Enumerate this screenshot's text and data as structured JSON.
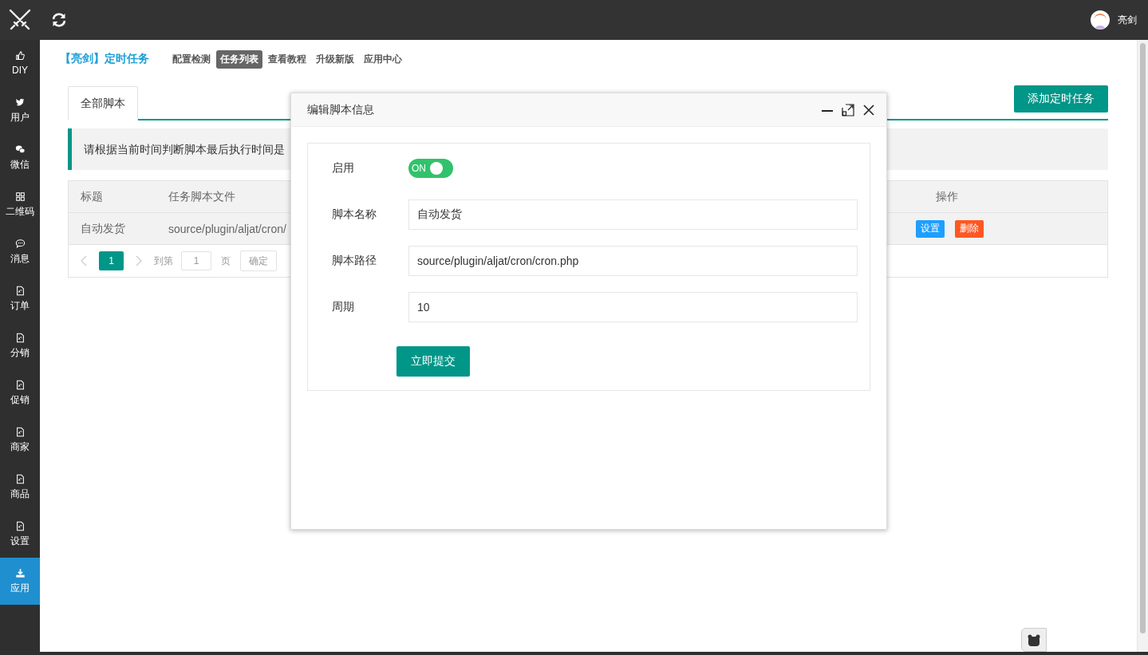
{
  "header": {
    "user_name": "亮剑"
  },
  "sidebar": {
    "items": [
      {
        "label": "DIY",
        "kind": "thumb",
        "selected": false
      },
      {
        "label": "用户",
        "kind": "bird",
        "selected": false
      },
      {
        "label": "微信",
        "kind": "chat",
        "selected": false
      },
      {
        "label": "二维码",
        "kind": "grid",
        "selected": false
      },
      {
        "label": "消息",
        "kind": "bubble",
        "selected": false
      },
      {
        "label": "订单",
        "kind": "doc",
        "selected": false
      },
      {
        "label": "分销",
        "kind": "doc",
        "selected": false
      },
      {
        "label": "促销",
        "kind": "doc",
        "selected": false
      },
      {
        "label": "商家",
        "kind": "doc",
        "selected": false
      },
      {
        "label": "商品",
        "kind": "doc",
        "selected": false
      },
      {
        "label": "设置",
        "kind": "doc",
        "selected": false
      },
      {
        "label": "应用",
        "kind": "download",
        "selected": true
      }
    ]
  },
  "page": {
    "title": "【亮剑】定时任务",
    "nav": [
      {
        "label": "配置检测",
        "selected": false
      },
      {
        "label": "任务列表",
        "selected": true
      },
      {
        "label": "查看教程",
        "selected": false
      },
      {
        "label": "升级新版",
        "selected": false
      },
      {
        "label": "应用中心",
        "selected": false
      }
    ]
  },
  "tabs": [
    {
      "label": "全部脚本",
      "selected": true
    }
  ],
  "add_button": "添加定时任务",
  "notice": "请根据当前时间判断脚本最后执行时间是",
  "table": {
    "columns": [
      "标题",
      "任务脚本文件",
      "操作"
    ],
    "rows": [
      {
        "title": "自动发货",
        "script_file": "source/plugin/aljat/cron/",
        "actions": [
          {
            "label": "设置",
            "kind": "edit"
          },
          {
            "label": "删除",
            "kind": "delete"
          }
        ]
      }
    ]
  },
  "pagination": {
    "pages": [
      {
        "label": "1",
        "selected": true
      }
    ],
    "goto_label": "到第",
    "page_input": "1",
    "page_unit": "页",
    "confirm": "确定"
  },
  "dialog": {
    "title": "编辑脚本信息",
    "fields": [
      {
        "kind": "switch",
        "label": "启用",
        "on": true,
        "text": "ON"
      },
      {
        "kind": "text",
        "label": "脚本名称",
        "value": "自动发货"
      },
      {
        "kind": "text",
        "label": "脚本路径",
        "value": "source/plugin/aljat/cron/cron.php"
      },
      {
        "kind": "text",
        "label": "周期",
        "value": "10"
      }
    ],
    "submit": "立即提交"
  }
}
